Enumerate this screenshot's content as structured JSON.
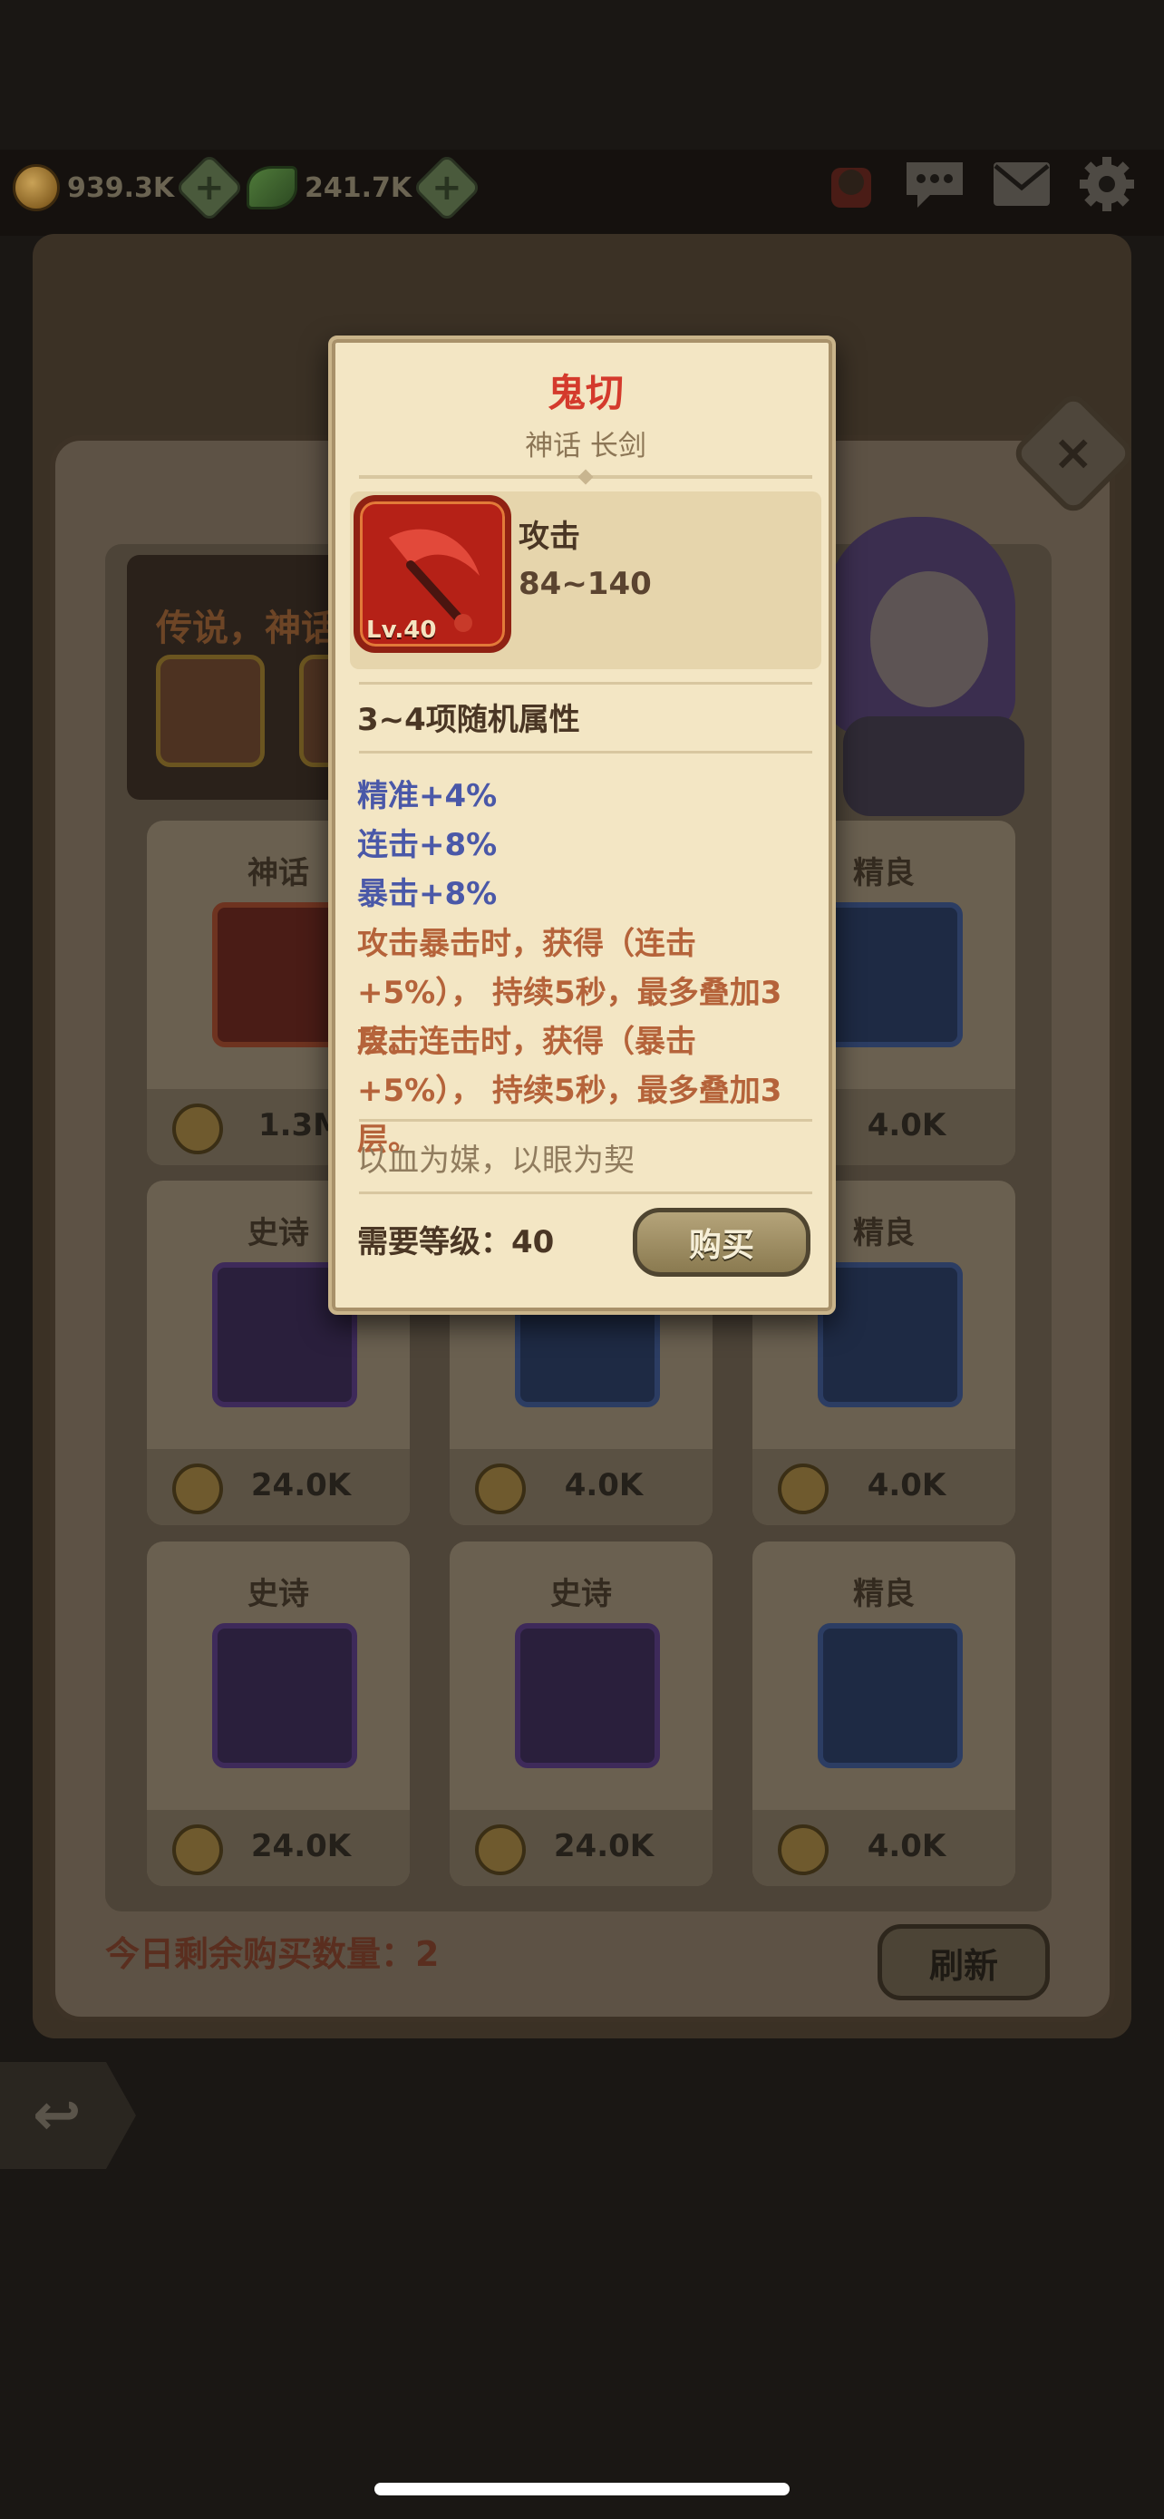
{
  "topbar": {
    "gold": "939.3K",
    "gem": "241.7K"
  },
  "shop": {
    "banner_text": "传说，神话",
    "items": [
      {
        "rarity": "神话",
        "price": "1.3M",
        "icon": "red-scythe-icon"
      },
      {
        "rarity": "",
        "price": "",
        "icon": ""
      },
      {
        "rarity": "精良",
        "price": "4.0K",
        "icon": "ring-icon"
      },
      {
        "rarity": "史诗",
        "price": "24.0K",
        "icon": "boots-icon"
      },
      {
        "rarity": "",
        "price": "4.0K",
        "icon": "robe-icon"
      },
      {
        "rarity": "精良",
        "price": "4.0K",
        "icon": "necklace-icon"
      },
      {
        "rarity": "史诗",
        "price": "24.0K",
        "icon": "glove-icon"
      },
      {
        "rarity": "史诗",
        "price": "24.0K",
        "icon": "shield-icon"
      },
      {
        "rarity": "精良",
        "price": "4.0K",
        "icon": "sickle-icon"
      }
    ],
    "remaining_label": "今日剩余购买数量：2",
    "refresh_label": "刷新"
  },
  "tooltip": {
    "name": "鬼切",
    "type": "神话 长剑",
    "level_badge": "Lv.40",
    "stat_label": "攻击",
    "stat_value": "84~140",
    "random_title": "3~4项随机属性",
    "attributes": [
      "精准+4%",
      "连击+8%",
      "暴击+8%"
    ],
    "effects": [
      "攻击暴击时，获得（连击+5%）， 持续5秒，最多叠加3层。",
      "攻击连击时，获得（暴击+5%）， 持续5秒，最多叠加3层。"
    ],
    "flavor": "以血为媒，以眼为契",
    "requirement": "需要等级：40",
    "buy_label": "购买",
    "name_color": "#d43a2c",
    "attr_color": "#4a58a8",
    "effect_color": "#b5633a"
  }
}
